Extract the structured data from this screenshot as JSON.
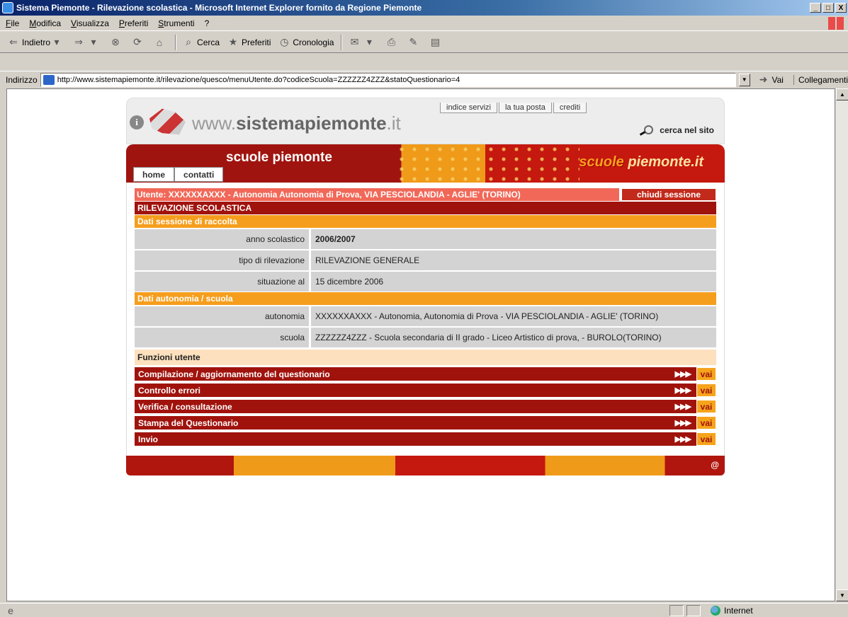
{
  "window": {
    "title": "Sistema Piemonte - Rilevazione scolastica - Microsoft Internet Explorer fornito da Regione Piemonte",
    "min": "_",
    "max": "□",
    "close": "X"
  },
  "menu": [
    "File",
    "Modifica",
    "Visualizza",
    "Preferiti",
    "Strumenti",
    "?"
  ],
  "toolbar": {
    "back": "Indietro",
    "search": "Cerca",
    "favorites": "Preferiti",
    "history": "Cronologia"
  },
  "address": {
    "label": "Indirizzo",
    "url": "http://www.sistemapiemonte.it/rilevazione/quesco/menuUtente.do?codiceScuola=ZZZZZZ4ZZZ&statoQuestionario=4",
    "go": "Vai",
    "links": "Collegamenti"
  },
  "site": {
    "logo_prefix": "www.",
    "logo_bold": "sistemapiemonte",
    "logo_suffix": ".it",
    "top_links": [
      "indice servizi",
      "la tua posta",
      "crediti"
    ],
    "search": "cerca nel sito",
    "banner_title": "scuole piemonte",
    "brand_1": "scuole",
    "brand_2": "piemonte",
    "brand_3": ".it",
    "nav": [
      "home",
      "contatti"
    ],
    "footer_symbol": "@"
  },
  "content": {
    "user": "Utente: XXXXXXAXXX - Autonomia Autonomia di Prova, VIA PESCIOLANDIA - AGLIE' (TORINO)",
    "close_session": "chiudi sessione",
    "main_title": "RILEVAZIONE SCOLASTICA",
    "section_session": "Dati sessione di raccolta",
    "anno_label": "anno scolastico",
    "anno_value": "2006/2007",
    "tipo_label": "tipo di rilevazione",
    "tipo_value": "RILEVAZIONE GENERALE",
    "situazione_label": "situazione al",
    "situazione_value": "15 dicembre 2006",
    "section_autonomia": "Dati autonomia / scuola",
    "autonomia_label": "autonomia",
    "autonomia_value": "XXXXXXAXXX - Autonomia, Autonomia di Prova - VIA PESCIOLANDIA - AGLIE' (TORINO)",
    "scuola_label": "scuola",
    "scuola_value": "ZZZZZZ4ZZZ - Scuola secondaria di II grado - Liceo Artistico di prova, - BUROLO(TORINO)",
    "functions_title": "Funzioni utente",
    "functions": [
      "Compilazione / aggiornamento del questionario",
      "Controllo errori",
      "Verifica / consultazione",
      "Stampa del Questionario",
      "Invio"
    ],
    "arrows": "▶▶▶",
    "go_label": "vai"
  },
  "status": {
    "zone": "Internet"
  }
}
